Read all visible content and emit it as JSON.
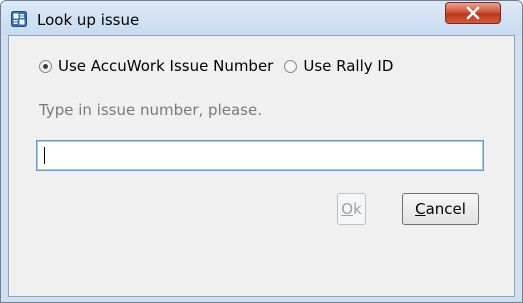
{
  "window": {
    "title": "Look up issue",
    "close_label": "x"
  },
  "options": {
    "accuwork_label": "Use AccuWork Issue Number",
    "accuwork_selected": true,
    "rally_label": "Use Rally ID",
    "rally_selected": false
  },
  "hint": "Type in issue number, please.",
  "issue_input": {
    "value": "",
    "placeholder": ""
  },
  "buttons": {
    "ok_mnemonic": "O",
    "ok_rest": "k",
    "ok_enabled": false,
    "cancel_mnemonic": "C",
    "cancel_rest": "ancel"
  },
  "colors": {
    "titlebar": "#c7daef",
    "client_bg": "#f0f0f0",
    "close_button": "#cc4b30",
    "input_focus_border": "#5d9bd6",
    "hint_text": "#7a7a7a",
    "disabled_text": "#a0a0a0"
  },
  "icons": {
    "app": "app-window-icon",
    "close": "close-icon"
  }
}
